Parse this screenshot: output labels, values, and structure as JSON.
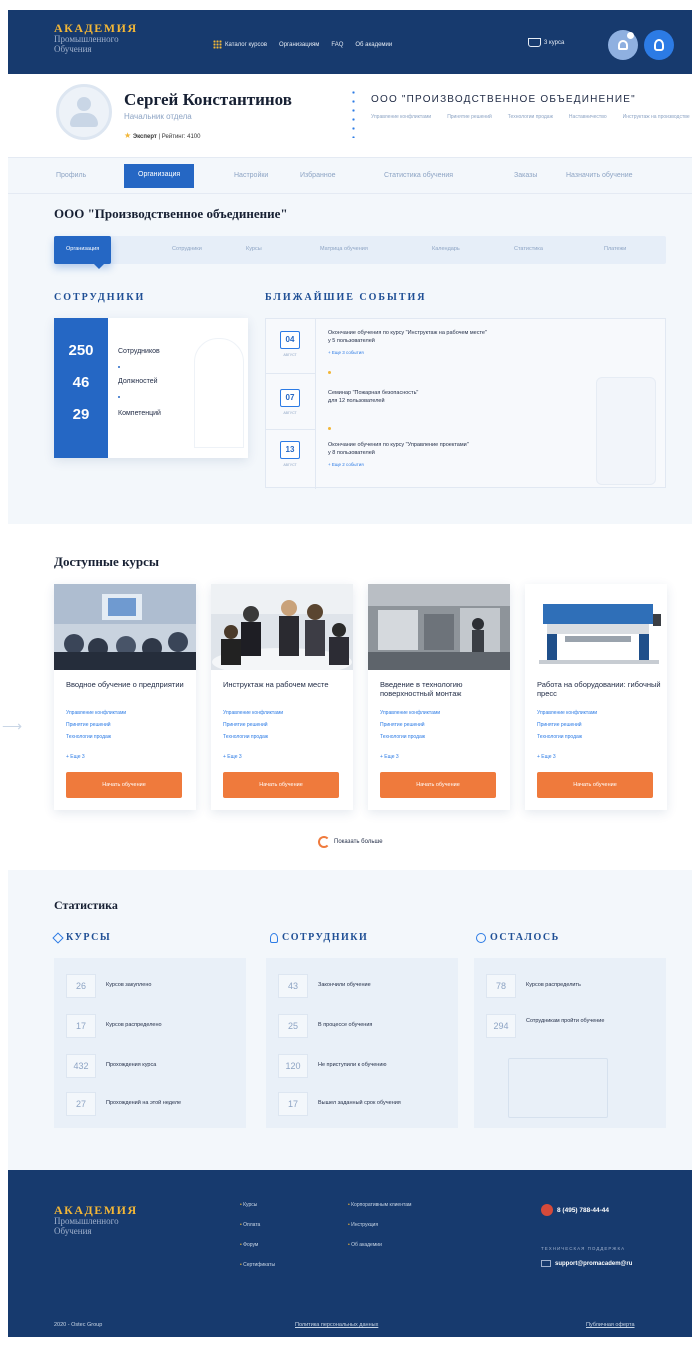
{
  "header": {
    "logo_main": "АКАДЕМИЯ",
    "logo_sub1": "Промышленного",
    "logo_sub2": "Обучения",
    "nav": [
      "Каталог курсов",
      "Организациям",
      "FAQ",
      "Об академии"
    ],
    "cart_label": "3 курса"
  },
  "profile": {
    "name": "Сергей Константинов",
    "role": "Начальник отдела",
    "badge": "Эксперт",
    "rating": "Рейтинг: 4100",
    "organization": "ООО \"ПРОИЗВОДСТВЕННОЕ ОБЪЕДИНЕНИЕ\"",
    "org_tags": [
      "Управление конфликтами",
      "Принятие решений",
      "Технологии продаж",
      "Наставничество",
      "Инструктаж на производстве"
    ]
  },
  "profile_tabs": [
    "Профиль",
    "Организация",
    "Настройки",
    "Избранное",
    "Статистика обучения",
    "Заказы",
    "Назначить обучение"
  ],
  "org_title": "ООО \"Производственное объединение\"",
  "org_tabs": [
    "Организация",
    "Сотрудники",
    "Курсы",
    "Матрица обучения",
    "Календарь",
    "Статистика",
    "Платежи"
  ],
  "employees": {
    "heading": "СОТРУДНИКИ",
    "items": [
      {
        "value": "250",
        "label": "Сотрудников"
      },
      {
        "value": "46",
        "label": "Должностей"
      },
      {
        "value": "29",
        "label": "Компетенций"
      }
    ]
  },
  "events": {
    "heading": "БЛИЖАЙШИЕ СОБЫТИЯ",
    "items": [
      {
        "day": "04",
        "month": "АВГУСТ",
        "title": "Окончание обучения по курсу \"Инструктаж на рабочем месте\"",
        "subtitle": "у 5 пользователей",
        "more": "+ Еще 3 события"
      },
      {
        "day": "07",
        "month": "АВГУСТ",
        "title": "Семинар \"Пожарная безопасность\"",
        "subtitle": "для 12 пользователей",
        "more": ""
      },
      {
        "day": "13",
        "month": "АВГУСТ",
        "title": "Окончание обучения по курсу \"Управление проектами\"",
        "subtitle": "у 8 пользователей",
        "more": "+ Еще 2 события"
      }
    ]
  },
  "courses": {
    "title": "Доступные курсы",
    "items": [
      {
        "title": "Вводное обучение о предприятии",
        "tags": [
          "Управление конфликтами",
          "Принятие решений",
          "Технологии продаж"
        ],
        "more": "+ Еще 3",
        "button": "Начать обучение"
      },
      {
        "title": "Инструктаж на рабочем месте",
        "tags": [
          "Управление конфликтами",
          "Принятие решений",
          "Технологии продаж"
        ],
        "more": "+ Еще 3",
        "button": "Начать обучение"
      },
      {
        "title": "Введение в технологию поверхностный монтаж",
        "tags": [
          "Управление конфликтами",
          "Принятие решений",
          "Технологии продаж"
        ],
        "more": "+ Еще 3",
        "button": "Начать обучение"
      },
      {
        "title": "Работа на оборудовании: гибочный пресс",
        "tags": [
          "Управление конфликтами",
          "Принятие решений",
          "Технологии продаж"
        ],
        "more": "+ Еще 3",
        "button": "Начать обучение"
      }
    ],
    "show_more": "Показать больше"
  },
  "stats": {
    "title": "Статистика",
    "columns": [
      {
        "heading": "КУРСЫ",
        "rows": [
          {
            "value": "26",
            "label": "Курсов закуплено"
          },
          {
            "value": "17",
            "label": "Курсов распределено"
          },
          {
            "value": "432",
            "label": "Прохождения курса"
          },
          {
            "value": "27",
            "label": "Прохождений на этой неделе"
          }
        ]
      },
      {
        "heading": "СОТРУДНИКИ",
        "rows": [
          {
            "value": "43",
            "label": "Закончили обучение"
          },
          {
            "value": "25",
            "label": "В процессе обучения"
          },
          {
            "value": "120",
            "label": "Не приступили к обучению"
          },
          {
            "value": "17",
            "label": "Вышел заданный срок обучения"
          }
        ]
      },
      {
        "heading": "ОСТАЛОСЬ",
        "rows": [
          {
            "value": "78",
            "label": "Курсов распределить"
          },
          {
            "value": "294",
            "label": "Сотрудникам пройти обучение"
          }
        ]
      }
    ]
  },
  "footer": {
    "logo_main": "АКАДЕМИЯ",
    "logo_sub1": "Промышленного",
    "logo_sub2": "Обучения",
    "col1": [
      "Курсы",
      "Оплата",
      "Форум",
      "Сертификаты"
    ],
    "col2": [
      "Корпоративным клиентам",
      "Инструкция",
      "Об академии"
    ],
    "phone": "8 (495) 788-44-44",
    "support_heading": "ТЕХНИЧЕСКАЯ ПОДДЕРЖКА",
    "support_email": "support@promacadem@ru",
    "copyright": "2020 - Ostec Group",
    "privacy": "Политика персональных данных",
    "offer": "Публичная оферта"
  },
  "colors": {
    "primary": "#173a6e",
    "accent": "#2567c4",
    "gold": "#f2b637",
    "orange": "#ef7a3c"
  }
}
